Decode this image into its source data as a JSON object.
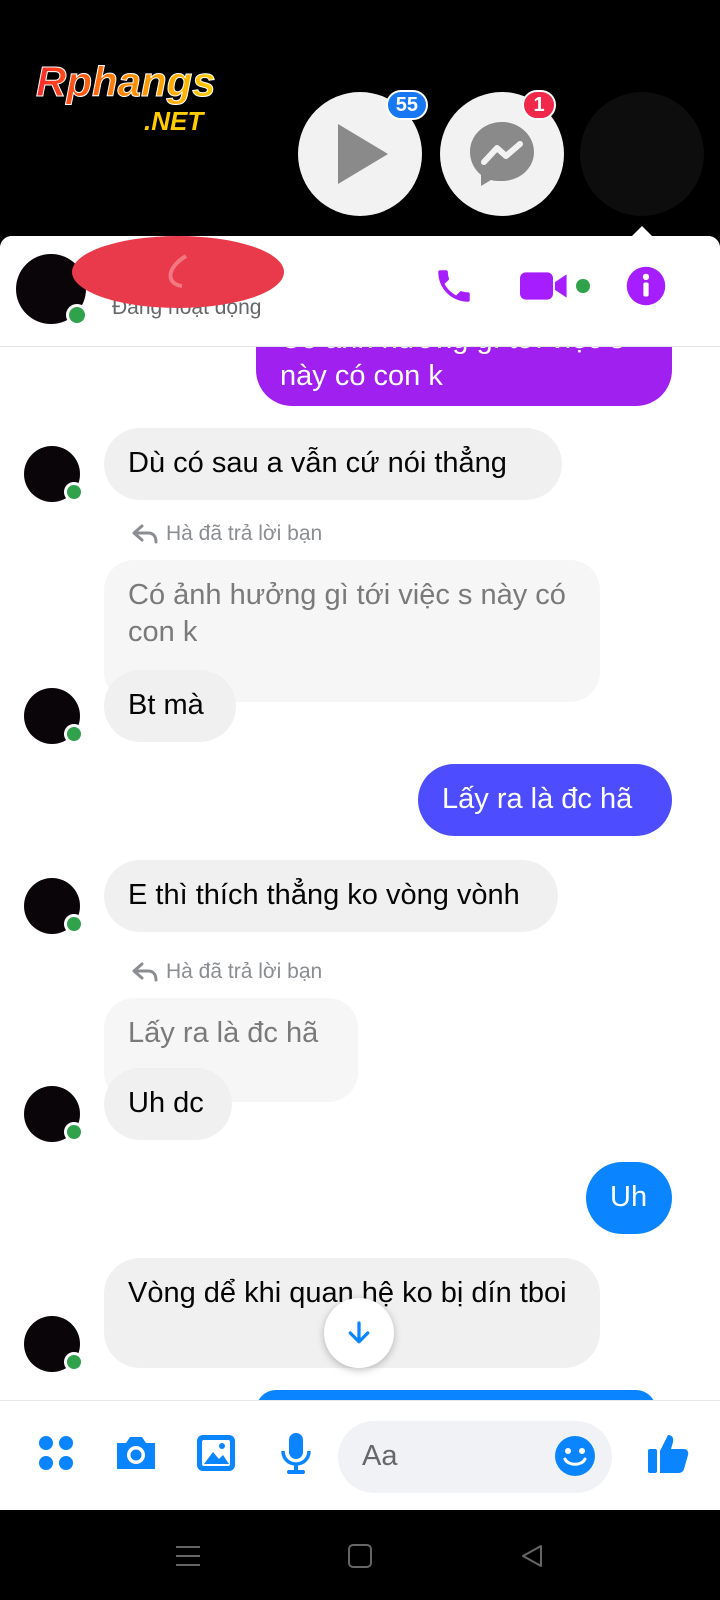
{
  "watermark": {
    "brand": "Rphangs",
    "domain": ".NET"
  },
  "chatheads": {
    "video_badge": "55",
    "messenger_badge": "1"
  },
  "header": {
    "status": "Đang hoạt động"
  },
  "messages": {
    "out1_text": "Có ảnh hưởng gì tới việc s\nnày có con k",
    "in1_text": "Dù có sau a vẫn cứ nói thẳng",
    "reply1_label": "Hà đã trả lời bạn",
    "reply1_quote": "Có ảnh hưởng gì tới việc s này có con k",
    "in2_text": "Bt mà",
    "out2_text": "Lấy ra là đc hã",
    "in3_text": "E thì thích thẳng ko vòng vònh",
    "reply2_label": "Hà đã trả lời bạn",
    "reply2_quote": "Lấy ra là đc hã",
    "in4_text": "Uh dc",
    "out3_text": "Uh",
    "in5_text": "Vòng dể khi quan hệ ko bị dín tboi"
  },
  "composer": {
    "placeholder": "Aa"
  },
  "colors": {
    "accent_purple": "#a020f0",
    "accent_indigo": "#4d4dff",
    "accent_blue": "#0a84ff",
    "messenger_blue": "#1877f2",
    "online_green": "#31a24c",
    "icon_purple": "#a61eff"
  }
}
